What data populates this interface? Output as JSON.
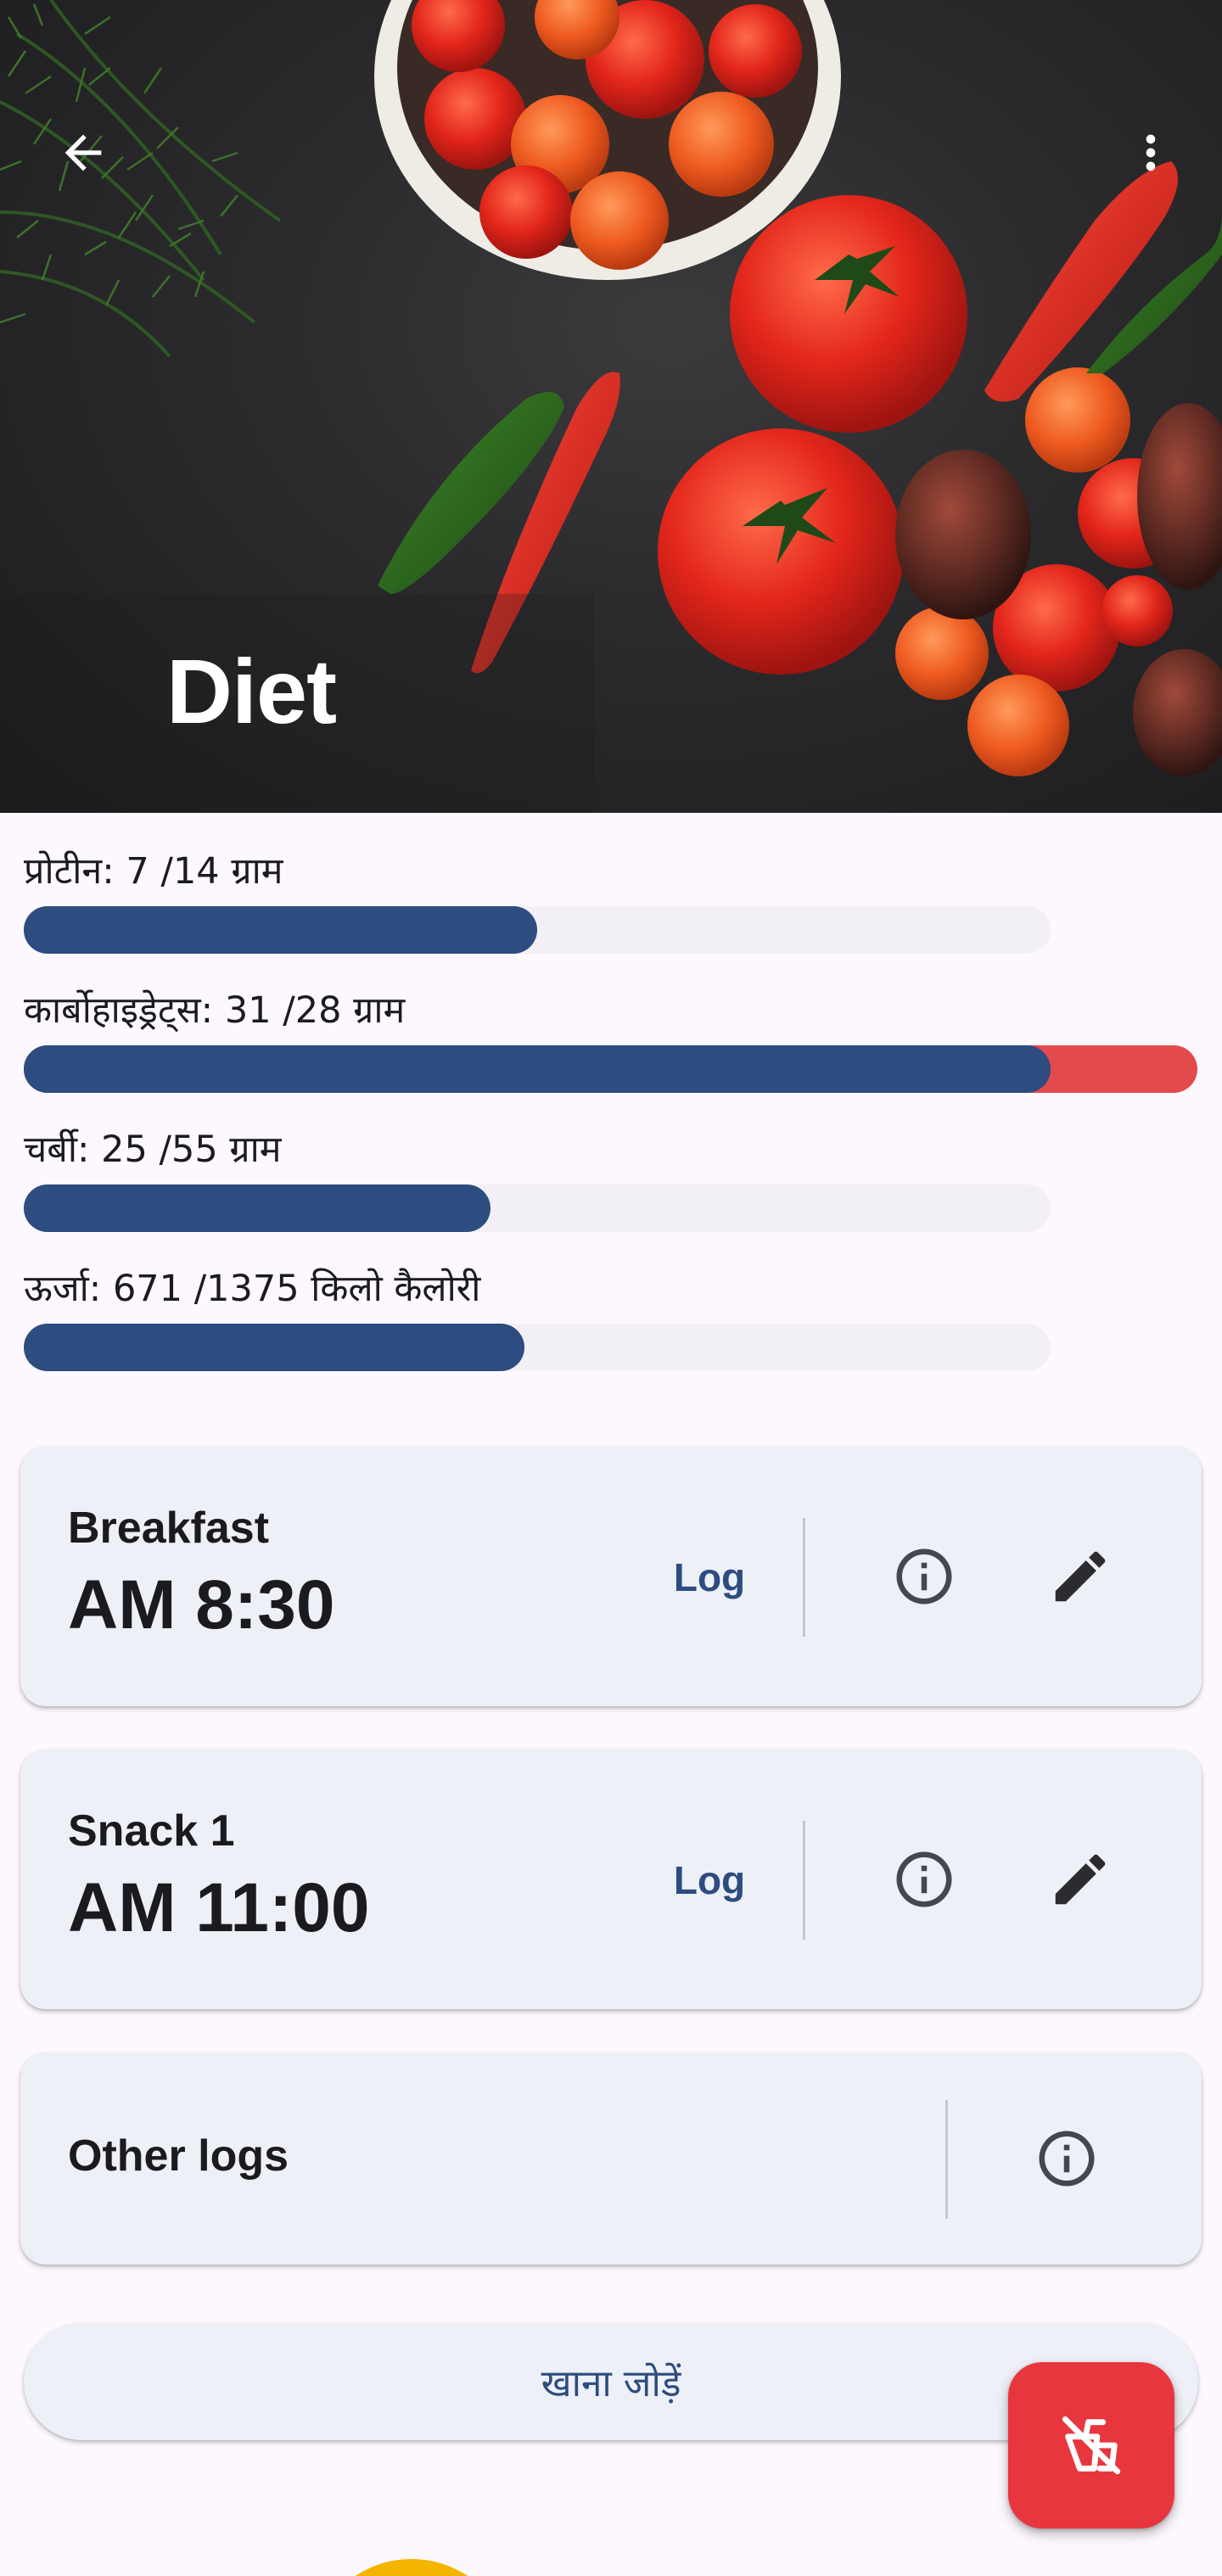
{
  "header": {
    "title": "Diet",
    "back_icon": "arrow-back-icon",
    "menu_icon": "more-vert-icon"
  },
  "nutrients": [
    {
      "label": "प्रोटीन: 7 /14 ग्राम",
      "progress": 0.5,
      "over": false
    },
    {
      "label": "कार्बोहाइड्रेट्स: 31 /28 ग्राम",
      "progress": 1.0,
      "over": true
    },
    {
      "label": "चर्बी: 25 /55 ग्राम",
      "progress": 0.4545,
      "over": false
    },
    {
      "label": "ऊर्जा: 671 /1375 किलो कैलोरी",
      "progress": 0.488,
      "over": false
    }
  ],
  "meals": [
    {
      "name": "Breakfast",
      "time": "AM 8:30",
      "log_label": "Log"
    },
    {
      "name": "Snack 1",
      "time": "AM 11:00",
      "log_label": "Log"
    }
  ],
  "other_logs": {
    "label": "Other logs"
  },
  "add_food": {
    "label": "खाना जोड़ें"
  },
  "colors": {
    "primary": "#2d4c7f",
    "over": "#e34a4c",
    "fab": "#e8363f",
    "card": "#eef0f7",
    "background": "#fcf8fd"
  }
}
